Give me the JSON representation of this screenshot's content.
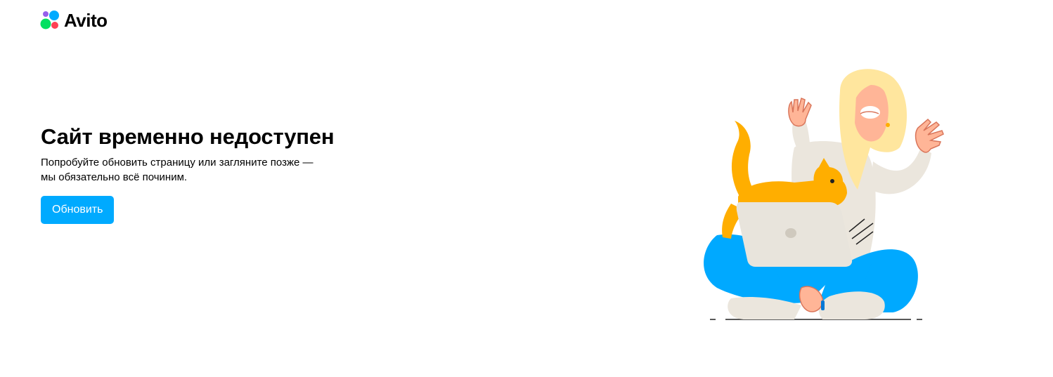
{
  "header": {
    "logo_text": "Avito",
    "logo_icon": "avito-dots-logo",
    "logo_colors": [
      "#965eeb",
      "#00aaff",
      "#04e061",
      "#ff4053"
    ]
  },
  "main": {
    "title": "Сайт временно недоступен",
    "subtitle_line1": "Попробуйте обновить страницу или загляните позже —",
    "subtitle_line2": "мы обязательно всё починим.",
    "refresh_button_label": "Обновить",
    "button_color": "#00aaff"
  },
  "illustration": {
    "icon": "woman-with-cat-and-laptop-illustration",
    "colors": {
      "pants": "#00a9ff",
      "cat": "#ffae00",
      "hair": "#ffe69e",
      "laptop": "#e8e4dc",
      "skin": "#ffb597"
    }
  }
}
